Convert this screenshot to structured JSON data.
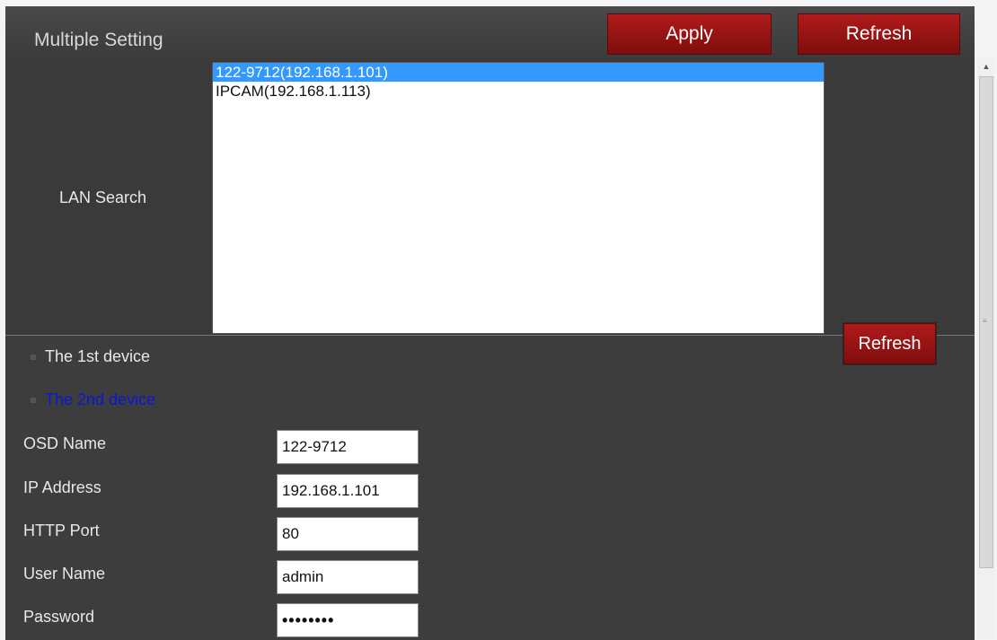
{
  "header": {
    "title": "Multiple Setting",
    "apply_label": "Apply",
    "refresh_label": "Refresh"
  },
  "lan_search": {
    "label": "LAN Search",
    "devices": [
      {
        "text": "122-9712(192.168.1.101)",
        "selected": true
      },
      {
        "text": "IPCAM(192.168.1.113)",
        "selected": false
      }
    ],
    "refresh_label": "Refresh"
  },
  "device_list": {
    "first": "The 1st device",
    "second": "The 2nd device"
  },
  "form": {
    "osd_name": {
      "label": "OSD Name",
      "value": "122-9712"
    },
    "ip_address": {
      "label": "IP Address",
      "value": "192.168.1.101"
    },
    "http_port": {
      "label": "HTTP Port",
      "value": "80"
    },
    "user_name": {
      "label": "User Name",
      "value": "admin"
    },
    "password": {
      "label": "Password",
      "value": "••••••••"
    }
  },
  "colors": {
    "panel_bg": "#3d3d3d",
    "button_red": "#9a1414",
    "selection_blue": "#3399ff",
    "active_device_text": "#0a16d8"
  },
  "icons": {
    "scroll_up": "triangle-up-icon",
    "scroll_grip": "grip-icon",
    "device_bullet": "square-bullet-icon"
  }
}
